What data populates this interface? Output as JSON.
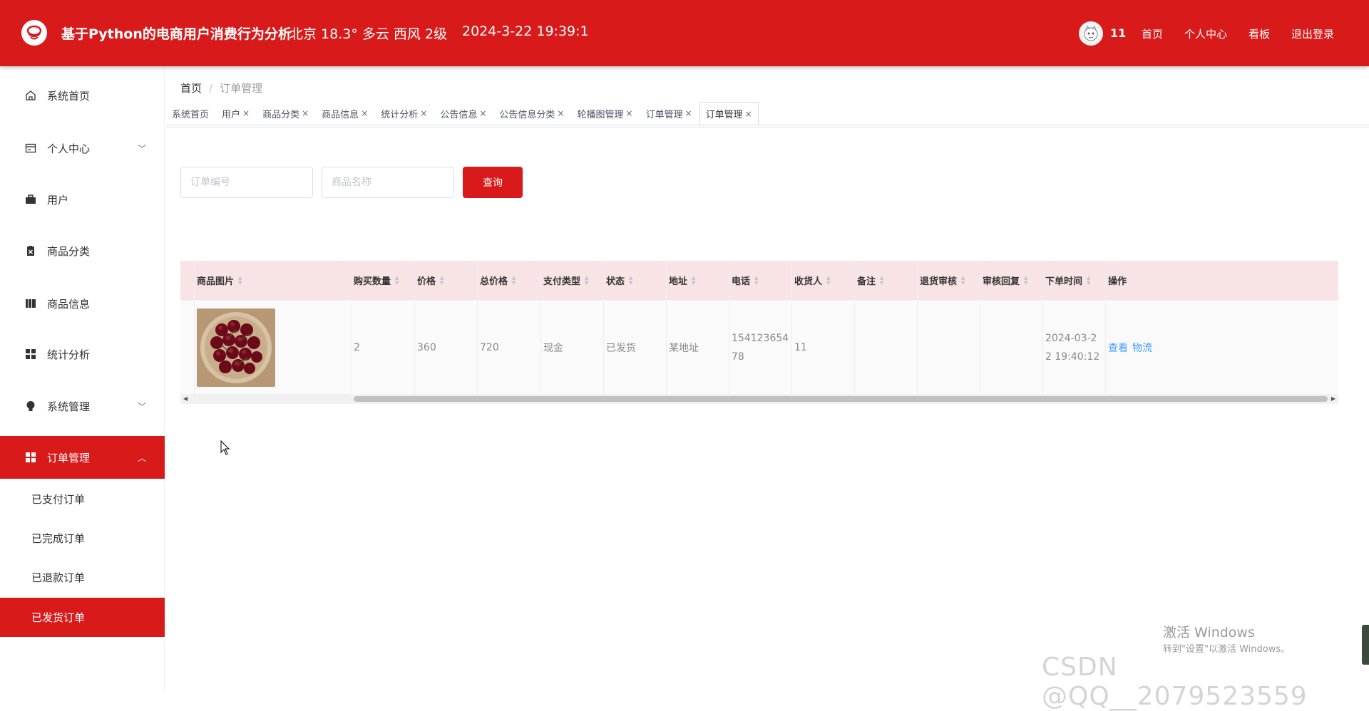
{
  "header": {
    "title": "基于Python的电商用户消费行为分析",
    "weather": "北京  18.3°  多云  西风  2级",
    "datetime": "2024-3-22 19:39:1",
    "username": "11",
    "nav": [
      "首页",
      "个人中心",
      "看板",
      "退出登录"
    ]
  },
  "sidebar": {
    "items": [
      {
        "label": "系统首页",
        "icon": "home-icon"
      },
      {
        "label": "个人中心",
        "icon": "card-icon",
        "arrow": "﹀"
      },
      {
        "label": "用户",
        "icon": "briefcase-icon"
      },
      {
        "label": "商品分类",
        "icon": "clipboard-icon"
      },
      {
        "label": "商品信息",
        "icon": "book-icon"
      },
      {
        "label": "统计分析",
        "icon": "grid-icon"
      },
      {
        "label": "系统管理",
        "icon": "bulb-icon",
        "arrow": "﹀"
      },
      {
        "label": "订单管理",
        "icon": "grid-icon",
        "arrow": "︿"
      }
    ],
    "sub_items": [
      "已支付订单",
      "已完成订单",
      "已退款订单",
      "已发货订单"
    ]
  },
  "breadcrumb": {
    "home": "首页",
    "current": "订单管理"
  },
  "tabs": [
    {
      "label": "系统首页",
      "closable": false
    },
    {
      "label": "用户",
      "closable": true
    },
    {
      "label": "商品分类",
      "closable": true
    },
    {
      "label": "商品信息",
      "closable": true
    },
    {
      "label": "统计分析",
      "closable": true
    },
    {
      "label": "公告信息",
      "closable": true
    },
    {
      "label": "公告信息分类",
      "closable": true
    },
    {
      "label": "轮播图管理",
      "closable": true
    },
    {
      "label": "订单管理",
      "closable": true
    },
    {
      "label": "订单管理",
      "closable": true,
      "active": true
    }
  ],
  "tab_close": "×",
  "search": {
    "order_no_placeholder": "订单编号",
    "product_name_placeholder": "商品名称",
    "query_label": "查询"
  },
  "table": {
    "columns": [
      "商品图片",
      "购买数量",
      "价格",
      "总价格",
      "支付类型",
      "状态",
      "地址",
      "电话",
      "收货人",
      "备注",
      "退货审核",
      "审核回复",
      "下单时间",
      "操作"
    ],
    "rows": [
      {
        "image": "cherries",
        "quantity": "2",
        "price": "360",
        "total": "720",
        "pay_type": "现金",
        "status": "已发货",
        "address": "某地址",
        "phone_l1": "154123654",
        "phone_l2": "78",
        "receiver": "11",
        "remark": "",
        "return_review": "",
        "review_reply": "",
        "time_l1": "2024-03-2",
        "time_l2": "2 19:40:12",
        "actions": [
          "查看",
          "物流"
        ]
      }
    ]
  },
  "watermark": {
    "win_title": "激活 Windows",
    "win_sub": "转到\"设置\"以激活 Windows。",
    "csdn": "CSDN @QQ__2079523559"
  },
  "colors": {
    "brand": "#d81a1a",
    "header_row": "#f8e4e4",
    "link": "#409eff"
  }
}
